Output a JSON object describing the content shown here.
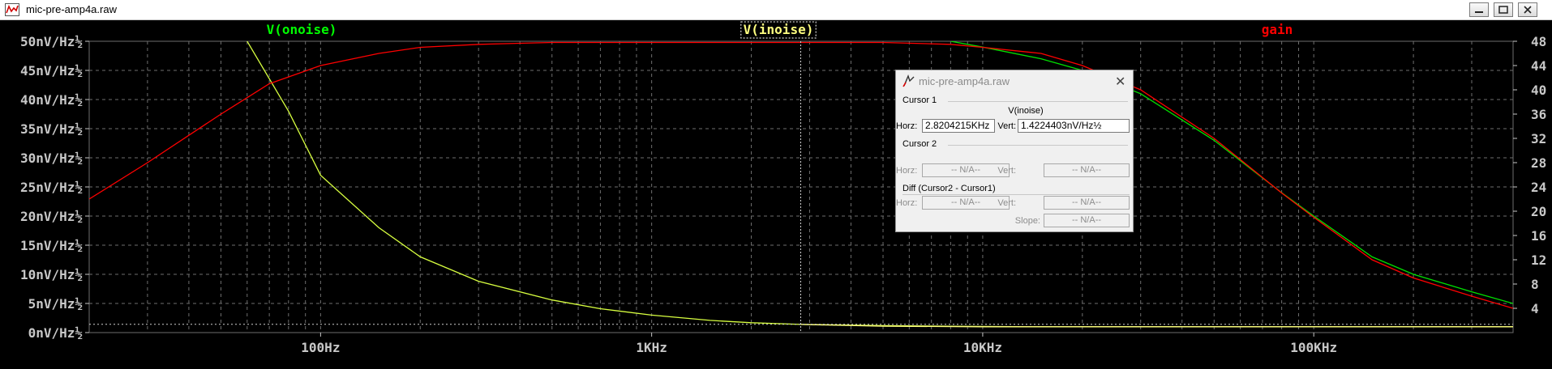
{
  "window": {
    "title": "mic-pre-amp4a.raw"
  },
  "plot": {
    "traces": [
      {
        "name": "V(onoise)",
        "color": "#00ff00"
      },
      {
        "name": "V(inoise)",
        "color": "#ffff80",
        "selected": true
      },
      {
        "name": "gain",
        "color": "#ff0000"
      }
    ],
    "left_axis_labels": [
      "50nV/Hz½",
      "45nV/Hz½",
      "40nV/Hz½",
      "35nV/Hz½",
      "30nV/Hz½",
      "25nV/Hz½",
      "20nV/Hz½",
      "15nV/Hz½",
      "10nV/Hz½",
      "5nV/Hz½",
      "0nV/Hz½"
    ],
    "right_axis_labels": [
      "48",
      "44",
      "40",
      "36",
      "32",
      "28",
      "24",
      "20",
      "16",
      "12",
      "8",
      "4"
    ],
    "x_axis_labels": [
      "100Hz",
      "1KHz",
      "10KHz",
      "100KHz"
    ],
    "colors": {
      "background": "#000000",
      "grid": "#6e6e6e",
      "axis_text": "#c8c8c8"
    }
  },
  "chart_data": {
    "type": "line",
    "x_scale": "log",
    "xlim": [
      20,
      400000
    ],
    "ylim_left_nV": [
      0,
      50
    ],
    "ylim_right": [
      0,
      48
    ],
    "grid": true,
    "cursor": {
      "x_Hz": 2820.4215,
      "trace": "V(inoise)"
    },
    "series": [
      {
        "name": "V(onoise)",
        "axis": "left",
        "x": [
          20,
          60,
          80,
          100,
          150,
          200,
          300,
          500,
          700,
          1000,
          1500,
          2000,
          2820,
          5000,
          8000,
          10000,
          15000,
          20000,
          30000,
          50000,
          80000,
          100000,
          150000,
          200000,
          300000,
          400000
        ],
        "y": [
          150,
          50,
          38,
          27,
          18,
          13,
          8.8,
          5.6,
          4.1,
          3,
          2.1,
          1.7,
          1.4,
          1.2,
          1.1,
          1.05,
          1.0,
          1.0,
          1.0,
          1.0,
          1.0,
          1.0,
          1.0,
          1.0,
          1.0,
          1.0
        ]
      },
      {
        "name": "V(inoise)",
        "axis": "left",
        "x": [
          2820,
          5000,
          10000,
          30000,
          100000,
          400000
        ],
        "y": [
          1.4,
          1.1,
          1.0,
          1.0,
          1.0,
          1.0
        ]
      },
      {
        "name": "V(onoise)-high",
        "axis": "left",
        "x": [
          8000,
          10000,
          15000,
          20000,
          30000,
          50000,
          80000,
          100000,
          150000,
          200000,
          300000,
          400000
        ],
        "y": [
          50,
          49,
          47,
          45,
          41,
          33,
          24,
          20,
          13,
          10,
          7,
          5
        ]
      },
      {
        "name": "gain",
        "axis": "right",
        "x": [
          20,
          30,
          50,
          70,
          100,
          150,
          200,
          300,
          500,
          1000,
          2000,
          3000,
          5000,
          8000,
          10000,
          15000,
          20000,
          30000,
          50000,
          80000,
          100000,
          150000,
          200000,
          300000,
          400000
        ],
        "y": [
          22,
          28,
          36,
          41,
          44,
          46,
          47,
          47.5,
          47.8,
          47.8,
          47.8,
          47.8,
          47.8,
          47.5,
          47,
          46,
          44,
          40,
          32,
          23,
          19,
          12,
          9,
          6,
          4
        ]
      }
    ]
  },
  "cursor_dialog": {
    "title": "mic-pre-amp4a.raw",
    "cursor1": {
      "heading": "Cursor 1",
      "trace": "V(inoise)",
      "horz_label": "Horz:",
      "horz_value": "2.8204215KHz",
      "vert_label": "Vert:",
      "vert_value": "1.4224403nV/Hz½"
    },
    "cursor2": {
      "heading": "Cursor 2",
      "horz_label": "Horz:",
      "horz_value": "-- N/A--",
      "vert_label": "Vert:",
      "vert_value": "-- N/A--"
    },
    "diff": {
      "heading": "Diff (Cursor2 - Cursor1)",
      "horz_label": "Horz:",
      "horz_value": "-- N/A--",
      "vert_label": "Vert:",
      "vert_value": "-- N/A--",
      "slope_label": "Slope:",
      "slope_value": "-- N/A--"
    }
  }
}
